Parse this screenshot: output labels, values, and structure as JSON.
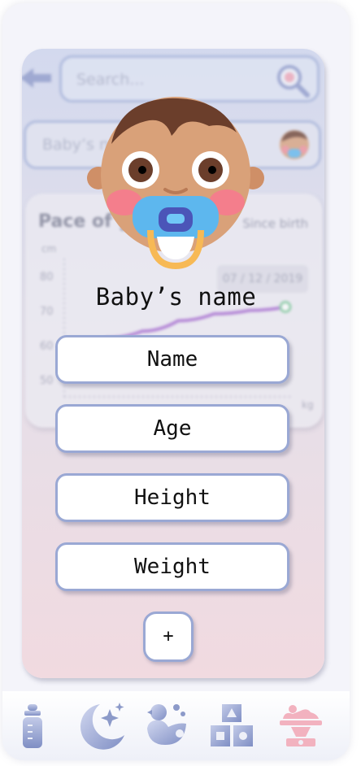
{
  "search": {
    "placeholder": "Search..."
  },
  "baby_name_field": {
    "placeholder": "Baby’s na"
  },
  "chart_card": {
    "title": "Pace of g",
    "since": "Since birth",
    "date": "07 / 12 / 2019",
    "y_unit": "cm",
    "x_unit": "kg",
    "y_ticks": [
      "80",
      "70",
      "60",
      "50"
    ]
  },
  "chart_data": {
    "type": "line",
    "title": "Pace of g",
    "ylabel": "cm",
    "xlabel": "kg",
    "ylim": [
      45,
      85
    ],
    "series": [
      {
        "values": [
          62,
          64,
          67,
          69,
          70,
          71
        ]
      }
    ],
    "grid": false
  },
  "profile": {
    "heading": "Baby’s name",
    "fields": [
      {
        "label": "Name"
      },
      {
        "label": "Age"
      },
      {
        "label": "Height"
      },
      {
        "label": "Weight"
      }
    ],
    "add_label": "+"
  },
  "nav": {
    "items": [
      {
        "icon": "bottle-icon"
      },
      {
        "icon": "moon-stars-icon"
      },
      {
        "icon": "duck-bath-icon"
      },
      {
        "icon": "toy-blocks-icon"
      },
      {
        "icon": "baby-scale-icon"
      }
    ],
    "active_index": 4,
    "colors": {
      "inactive": "#8c9ac9",
      "active": "#f2b2bf"
    }
  }
}
